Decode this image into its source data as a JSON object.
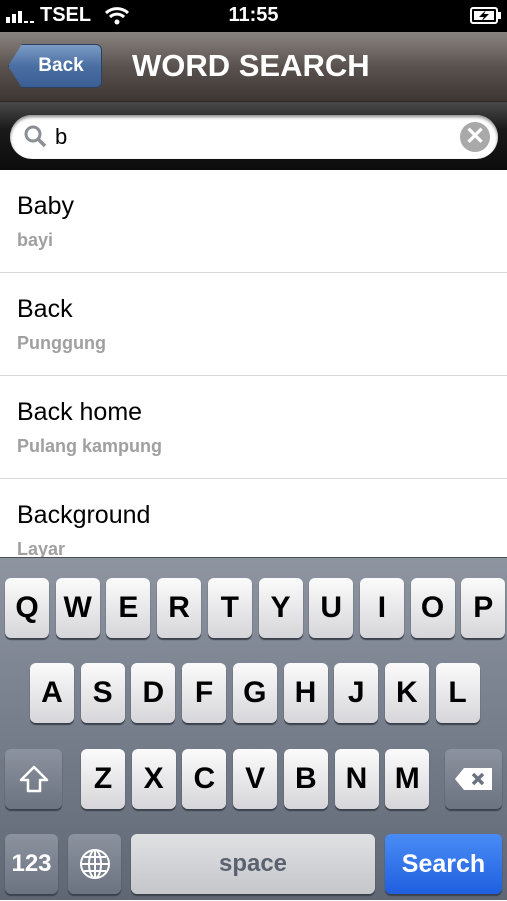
{
  "status": {
    "carrier": "TSEL",
    "time": "11:55"
  },
  "nav": {
    "back_label": "Back",
    "title": "WORD SEARCH"
  },
  "search": {
    "value": "b",
    "clear_icon": "✕"
  },
  "results": [
    {
      "word": "Baby",
      "translation": "bayi"
    },
    {
      "word": "Back",
      "translation": "Punggung"
    },
    {
      "word": "Back home",
      "translation": "Pulang kampung"
    },
    {
      "word": "Background",
      "translation": "Layar"
    }
  ],
  "keyboard": {
    "row1": [
      "Q",
      "W",
      "E",
      "R",
      "T",
      "Y",
      "U",
      "I",
      "O",
      "P"
    ],
    "row2": [
      "A",
      "S",
      "D",
      "F",
      "G",
      "H",
      "J",
      "K",
      "L"
    ],
    "row3": [
      "Z",
      "X",
      "C",
      "V",
      "B",
      "N",
      "M"
    ],
    "numbers": "123",
    "space": "space",
    "search": "Search"
  }
}
